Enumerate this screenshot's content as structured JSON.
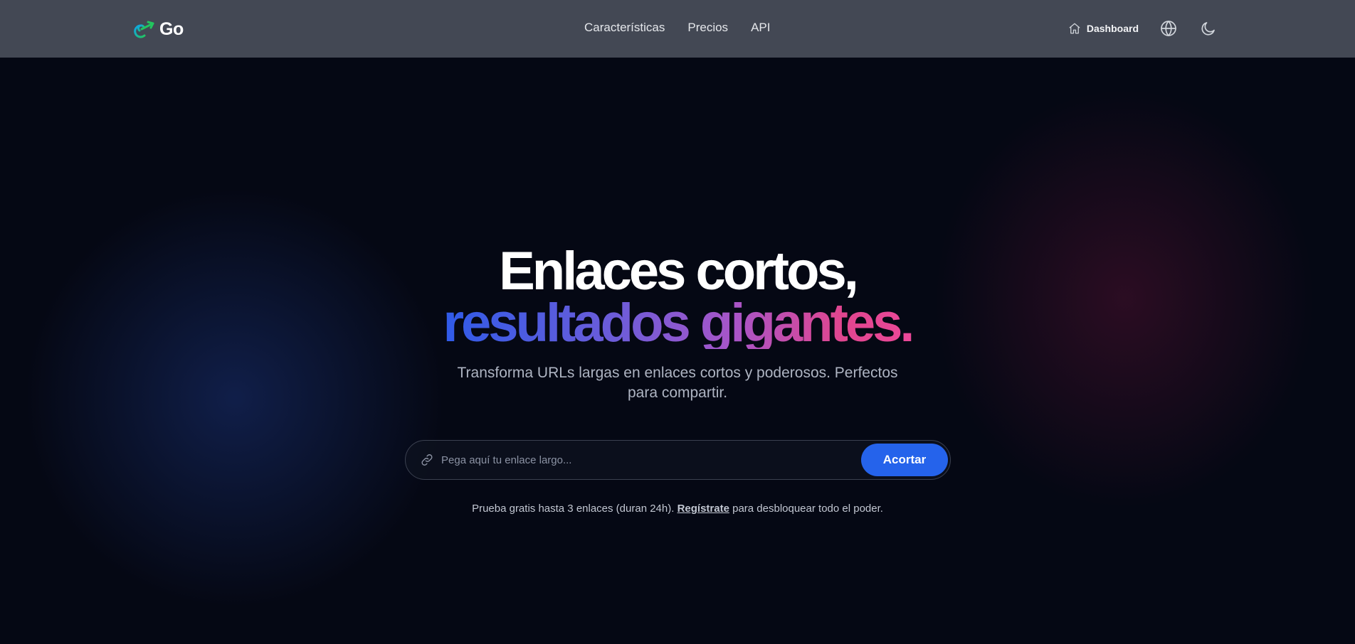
{
  "header": {
    "brand": "Go",
    "nav": [
      "Características",
      "Precios",
      "API"
    ],
    "dashboard_label": "Dashboard"
  },
  "hero": {
    "title_line1": "Enlaces cortos,",
    "title_line2": "resultados gigantes.",
    "subtitle": "Transforma URLs largas en enlaces cortos y poderosos. Perfectos para compartir."
  },
  "form": {
    "placeholder": "Pega aquí tu enlace largo...",
    "value": "",
    "button_label": "Acortar"
  },
  "note": {
    "prefix": "Prueba gratis hasta 3 enlaces (duran 24h). ",
    "link": "Regístrate",
    "suffix": " para desbloquear todo el poder."
  },
  "icons": {
    "brand": "link-arrow-icon",
    "dashboard": "home-icon",
    "language": "globe-icon",
    "theme": "moon-icon",
    "input": "link-icon"
  },
  "colors": {
    "header_bg": "#434854",
    "page_bg": "#050814",
    "primary": "#2563eb",
    "gradient_start": "#2f5be8",
    "gradient_end": "#ec4899",
    "brand_icon": "#14b8a6"
  }
}
